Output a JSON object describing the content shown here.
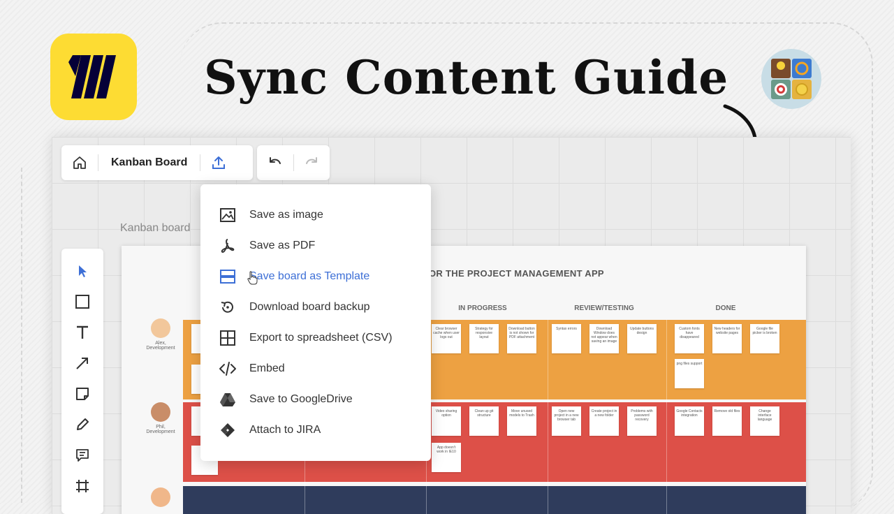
{
  "headline": "Sync Content Guide",
  "colors": {
    "accent_yellow": "#fddc33",
    "menu_active": "#3d6fd6",
    "lane_orange": "#eda142",
    "lane_red": "#dd5048",
    "lane_navy": "#2f3c5c"
  },
  "toolbar": {
    "home_icon": "home-icon",
    "board_title": "Kanban Board",
    "export_icon": "upload-icon",
    "undo_icon": "undo-icon",
    "redo_icon": "redo-icon"
  },
  "board_label": "Kanban board",
  "tools": [
    "cursor-icon",
    "rectangle-icon",
    "text-icon",
    "arrow-icon",
    "sticky-note-icon",
    "pen-icon",
    "comment-icon",
    "frame-icon"
  ],
  "menu": {
    "items": [
      {
        "label": "Save as image",
        "icon": "image-icon"
      },
      {
        "label": "Save as PDF",
        "icon": "pdf-icon"
      },
      {
        "label": "Save board as Template",
        "icon": "template-icon",
        "active": true
      },
      {
        "label": "Download board backup",
        "icon": "backup-icon"
      },
      {
        "label": "Export to spreadsheet (CSV)",
        "icon": "table-icon"
      },
      {
        "label": "Embed",
        "icon": "code-icon"
      },
      {
        "label": "Save to GoogleDrive",
        "icon": "google-drive-icon"
      },
      {
        "label": "Attach to JIRA",
        "icon": "jira-icon"
      }
    ]
  },
  "kanban": {
    "heading": "OR THE PROJECT MANAGEMENT APP",
    "columns": [
      "IN PROGRESS",
      "REVIEW/TESTING",
      "DONE"
    ],
    "people": [
      {
        "name": "Alex,",
        "role": "Development"
      },
      {
        "name": "Phil,",
        "role": "Development"
      }
    ],
    "notes": {
      "in_progress_orange": [
        "Clear browser cache when user logs out",
        "Strategy for responsive layout",
        "Download button is not shown for PDF attachment"
      ],
      "review_orange": [
        "Syntax errors",
        "Download Window does not appear when saving an image",
        "Update buttons design"
      ],
      "done_orange": [
        "Custom fonts have disappeared",
        "New headers for website pages",
        "Google file picker is broken",
        "png files support"
      ],
      "in_progress_red": [
        "Video sharing option",
        "Clean up git structure",
        "Move unused models to Trash",
        "App doesn't work in IE10"
      ],
      "review_red": [
        "Open new project in a new browser tab",
        "Create project in a new folder",
        "Problems with password recovery"
      ],
      "done_red": [
        "Google Contacts integration",
        "Remove old files",
        "Change interface language"
      ]
    }
  }
}
